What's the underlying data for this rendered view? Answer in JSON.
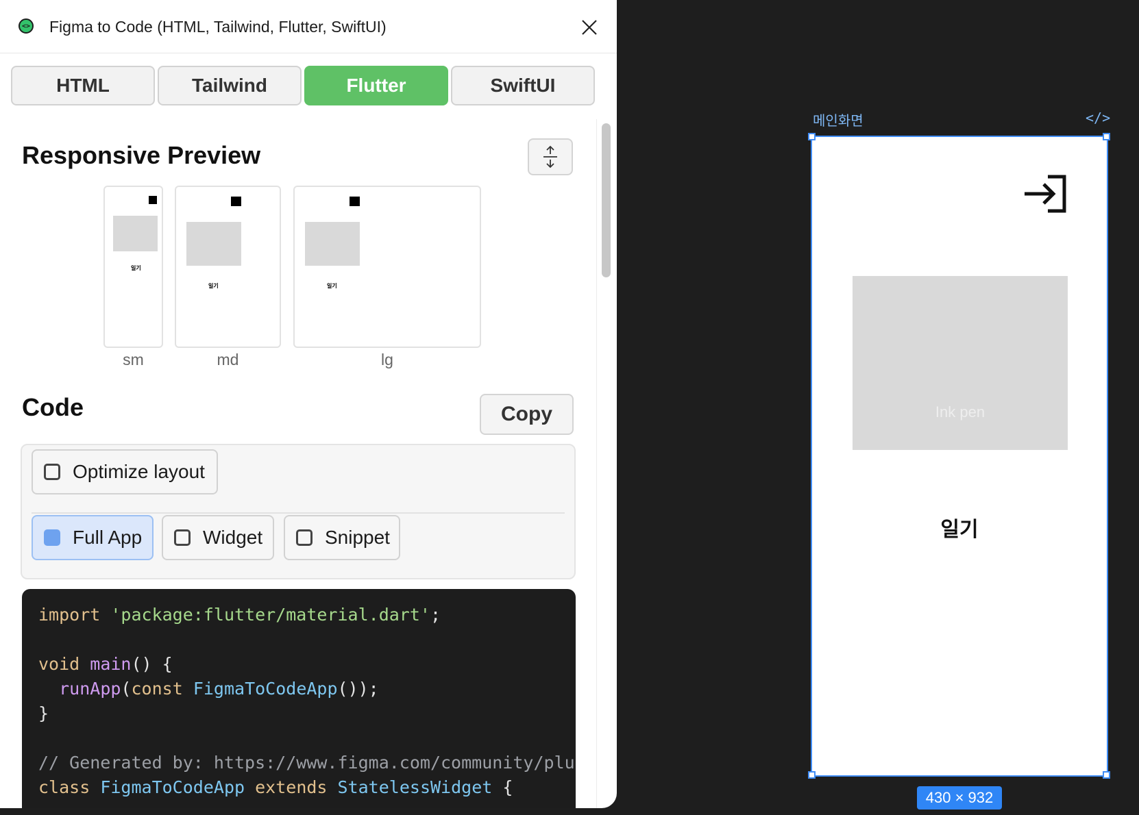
{
  "plugin": {
    "title": "Figma to Code (HTML, Tailwind, Flutter, SwiftUI)",
    "tabs": [
      {
        "label": "HTML",
        "active": false
      },
      {
        "label": "Tailwind",
        "active": false
      },
      {
        "label": "Flutter",
        "active": true
      },
      {
        "label": "SwiftUI",
        "active": false
      }
    ],
    "active_color": "#5fc166"
  },
  "preview": {
    "heading": "Responsive Preview",
    "sizes": [
      "sm",
      "md",
      "lg"
    ],
    "item_text": "일기"
  },
  "code_section": {
    "heading": "Code",
    "copy_label": "Copy",
    "optimize_label": "Optimize layout",
    "optimize_checked": false,
    "modes": [
      {
        "label": "Full App",
        "selected": true
      },
      {
        "label": "Widget",
        "selected": false
      },
      {
        "label": "Snippet",
        "selected": false
      }
    ],
    "lines": [
      "import 'package:flutter/material.dart';",
      "",
      "void main() {",
      "  runApp(const FigmaToCodeApp());",
      "}",
      "",
      "// Generated by: https://www.figma.com/community/plugi",
      "class FigmaToCodeApp extends StatelessWidget {"
    ]
  },
  "canvas": {
    "frame_name": "메인화면",
    "code_icon": "</>",
    "placeholder_text": "Ink pen",
    "frame_text": "일기",
    "size_badge": "430 × 932",
    "selection_color": "#3f8cf5"
  }
}
